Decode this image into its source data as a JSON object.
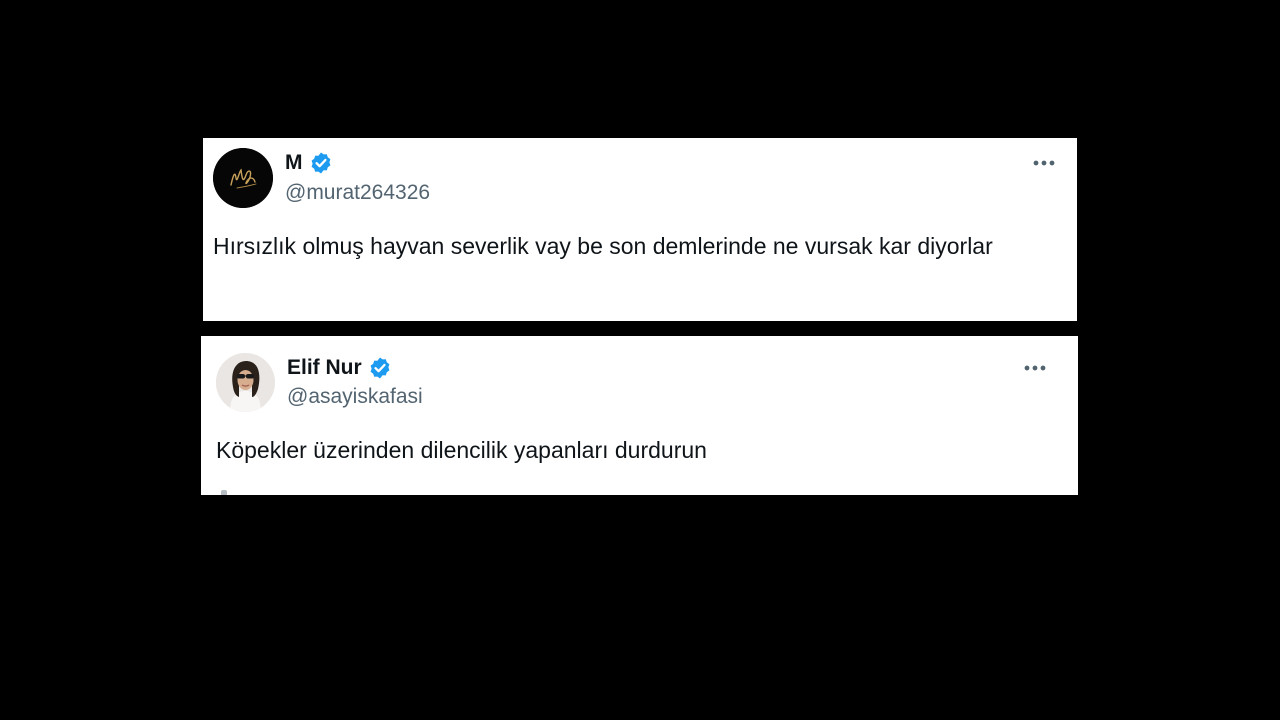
{
  "tweets": [
    {
      "display_name": "M",
      "handle": "@murat264326",
      "verified": true,
      "text": "Hırsızlık olmuş hayvan severlik vay be son demlerinde ne vursak kar diyorlar",
      "avatar": "signature-logo-avatar",
      "more_icon": "more-horizontal-icon"
    },
    {
      "display_name": "Elif Nur",
      "handle": "@asayiskafasi",
      "verified": true,
      "text": "Köpekler üzerinden dilencilik yapanları durdurun",
      "avatar": "profile-photo-avatar",
      "more_icon": "more-horizontal-icon"
    }
  ],
  "colors": {
    "background": "#000000",
    "card": "#ffffff",
    "primary_text": "#0f1419",
    "secondary_text": "#536471",
    "verified_badge": "#1d9bf0"
  }
}
